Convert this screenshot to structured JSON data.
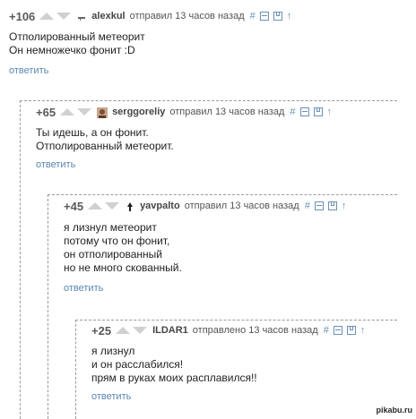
{
  "comments": [
    {
      "rating": "+106",
      "author": "alexkul",
      "meta": "отправил 13 часов назад",
      "lines": [
        "Отполированный метеорит",
        "Он немножечко фонит :D"
      ],
      "reply": "ответить"
    },
    {
      "rating": "+65",
      "author": "serggoreliy",
      "meta": "отправил 13 часов назад",
      "lines": [
        "Ты идешь, а он фонит.",
        "Отполированный метеорит."
      ],
      "reply": "ответить"
    },
    {
      "rating": "+45",
      "author": "yavpalto",
      "meta": "отправил 13 часов назад",
      "lines": [
        "я лизнул метеорит",
        "потому что он фонит,",
        "он отполированный",
        "но не много скованный."
      ],
      "reply": "ответить"
    },
    {
      "rating": "+25",
      "author": "ILDAR1",
      "meta": "отправлено 13 часов назад",
      "lines": [
        "я лизнул",
        "и он расслабился!",
        "прям в руках моих расплавился!!"
      ],
      "reply": "ответить"
    }
  ],
  "tools": {
    "hash": "#",
    "up": "↑"
  },
  "watermark": "pikabu.ru",
  "icons": [
    "upvote-arrow-icon",
    "downvote-arrow-icon",
    "collapse-icon",
    "save-icon",
    "go-up-icon"
  ]
}
